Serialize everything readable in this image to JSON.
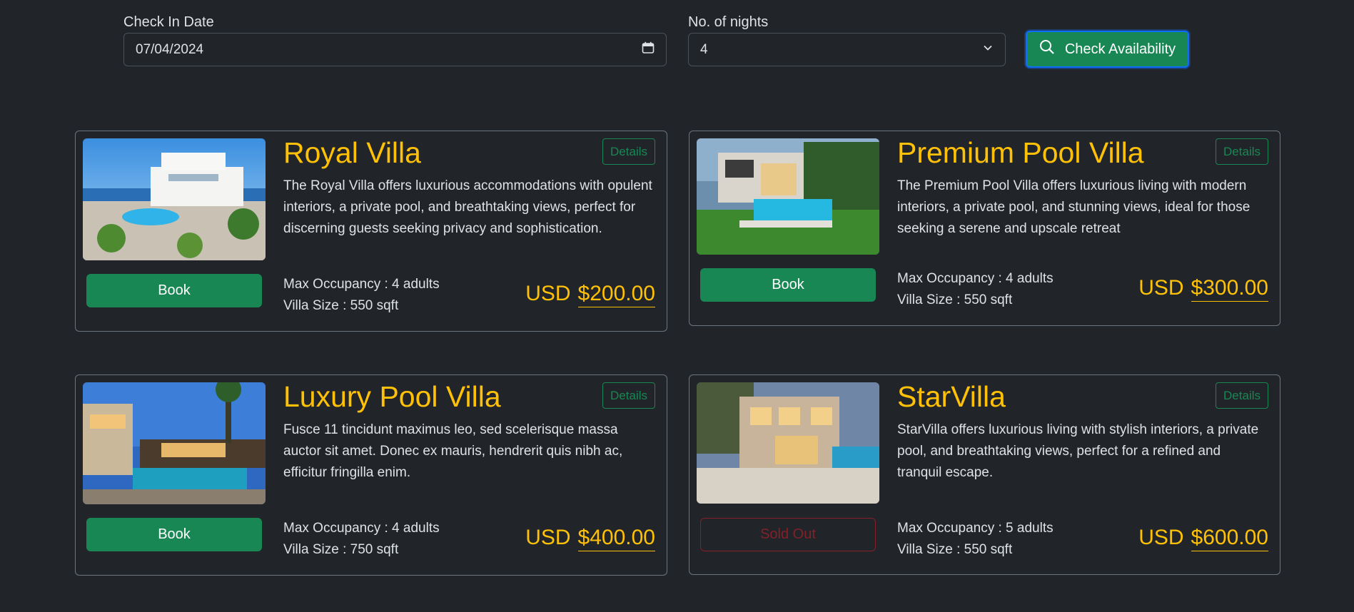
{
  "search": {
    "checkin_label": "Check In Date",
    "checkin_value": "07/04/2024",
    "nights_label": "No. of nights",
    "nights_value": "4",
    "check_button": "Check Availability"
  },
  "villas": [
    {
      "name": "Royal Villa",
      "details_label": "Details",
      "description": "The Royal Villa offers luxurious accommodations with opulent interiors, a private pool, and breathtaking views, perfect for discerning guests seeking privacy and sophistication.",
      "occupancy": "Max Occupancy : 4 adults",
      "size": "Villa Size : 550 sqft",
      "currency": "USD",
      "price": "$200.00",
      "action": "Book",
      "sold_out": false
    },
    {
      "name": "Premium Pool Villa",
      "details_label": "Details",
      "description": "The Premium Pool Villa offers luxurious living with modern interiors, a private pool, and stunning views, ideal for those seeking a serene and upscale retreat",
      "occupancy": "Max Occupancy : 4 adults",
      "size": "Villa Size : 550 sqft",
      "currency": "USD",
      "price": "$300.00",
      "action": "Book",
      "sold_out": false
    },
    {
      "name": "Luxury Pool Villa",
      "details_label": "Details",
      "description": "Fusce 11 tincidunt maximus leo, sed scelerisque massa auctor sit amet. Donec ex mauris, hendrerit quis nibh ac, efficitur fringilla enim.",
      "occupancy": "Max Occupancy : 4 adults",
      "size": "Villa Size : 750 sqft",
      "currency": "USD",
      "price": "$400.00",
      "action": "Book",
      "sold_out": false
    },
    {
      "name": "StarVilla",
      "details_label": "Details",
      "description": "StarVilla offers luxurious living with stylish interiors, a private pool, and breathtaking views, perfect for a refined and tranquil escape.",
      "occupancy": "Max Occupancy : 5 adults",
      "size": "Villa Size : 550 sqft",
      "currency": "USD",
      "price": "$600.00",
      "action": "Sold Out",
      "sold_out": true
    }
  ],
  "colors": {
    "background": "#212529",
    "accent_green": "#198754",
    "title_yellow": "#ffc107",
    "sold_out_red": "#842029"
  }
}
